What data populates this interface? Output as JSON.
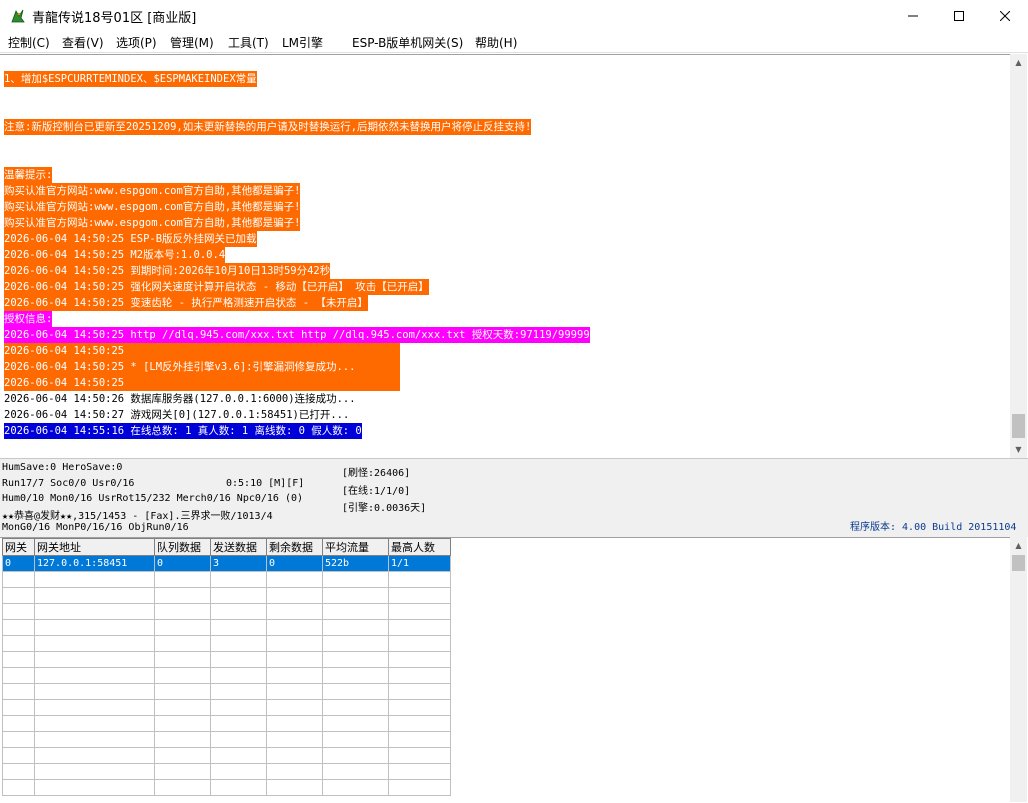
{
  "window": {
    "title": "青龍传说18号01区 [商业版]"
  },
  "menu": [
    "控制(C)",
    "查看(V)",
    "选项(P)",
    "管理(M)",
    "工具(T)",
    "LM引擎",
    "ESP-B版单机网关(S)",
    "帮助(H)"
  ],
  "log": [
    {
      "text": "1、增加$ESPCURRTEMINDEX、$ESPMAKEINDEX常量",
      "style": "o"
    },
    {
      "text": "注意:新版控制台已更新至20251209,如未更新替换的用户请及时替换运行,后期依然未替换用户将停止反挂支持!",
      "style": "o"
    },
    {
      "text": "温馨提示:",
      "style": "o"
    },
    {
      "text": "购买认准官方网站:www.espgom.com官方自助,其他都是骗子!",
      "style": "o"
    },
    {
      "text": "购买认准官方网站:www.espgom.com官方自助,其他都是骗子!",
      "style": "o"
    },
    {
      "text": "购买认准官方网站:www.espgom.com官方自助,其他都是骗子!",
      "style": "o"
    },
    {
      "text": "2026-06-04 14:50:25 ESP-B版反外挂网关已加载",
      "style": "o"
    },
    {
      "text": "2026-06-04 14:50:25 M2版本号:1.0.0.4",
      "style": "o"
    },
    {
      "text": "2026-06-04 14:50:25 到期时间:2026年10月10日13时59分42秒",
      "style": "o"
    },
    {
      "text": "2026-06-04 14:50:25 强化网关速度计算开启状态 - 移动【已开启】 攻击【已开启】",
      "style": "o"
    },
    {
      "text": "2026-06-04 14:50:25 变速齿轮 - 执行严格测速开启状态 - 【未开启】",
      "style": "o"
    },
    {
      "text": "授权信息:",
      "style": "m"
    },
    {
      "text": "2026-06-04 14:50:25 http //dlq.945.com/xxx.txt http //dlq.945.com/xxx.txt 授权天数:97119/99999",
      "style": "m"
    },
    {
      "text": "2026-06-04 14:50:25",
      "style": "o"
    },
    {
      "text": "2026-06-04 14:50:25 * [LM反外挂引擎v3.6]:引擎漏洞修复成功...",
      "style": "o"
    },
    {
      "text": "2026-06-04 14:50:25",
      "style": "o"
    },
    {
      "text": "2026-06-04 14:50:26 数据库服务器(127.0.0.1:6000)连接成功...",
      "style": "k"
    },
    {
      "text": "2026-06-04 14:50:27 游戏网关[0](127.0.0.1:58451)已打开...",
      "style": "k"
    },
    {
      "text": "2026-06-04 14:55:16 在线总数: 1 真人数: 1 离线数: 0 假人数: 0",
      "style": "b"
    }
  ],
  "status": {
    "line1": "HumSave:0 HeroSave:0",
    "line2a": "Run17/7 Soc0/0 Usr0/16",
    "line2b": "0:5:10 [M][F]",
    "line3": "Hum0/10 Mon0/16 UsrRot15/232 Merch0/16 Npc0/16 (0)",
    "line4": "★★恭喜@发财★★,315/1453 - [Fax].三界求一败/1013/4",
    "line5": "MonG0/16 MonP0/16/16 ObjRun0/16",
    "box1": "[刷怪:26406]",
    "box2": "[在线:1/1/0]",
    "box3": "[引擎:0.0036天]",
    "version": "程序版本: 4.00 Build 20151104"
  },
  "grid": {
    "headers": [
      "网关",
      "网关地址",
      "队列数据",
      "发送数据",
      "剩余数据",
      "平均流量",
      "最高人数"
    ],
    "rows": [
      [
        "0",
        "127.0.0.1:58451",
        "0",
        "3",
        "0",
        "522b",
        "1/1"
      ]
    ]
  },
  "colors": {
    "orange": "#ff6a00",
    "magenta": "#ff00ff",
    "blue": "#0000d8",
    "selection": "#0078d7"
  }
}
